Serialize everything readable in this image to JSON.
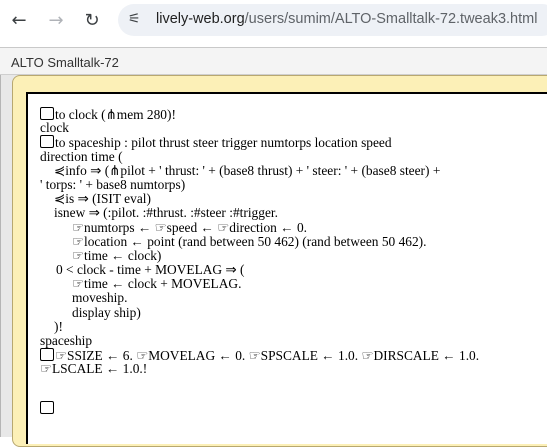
{
  "browser": {
    "back_glyph": "←",
    "forward_glyph": "→",
    "reload_glyph": "↻",
    "site_info_glyph": "⚟",
    "url_host": "lively-web.org",
    "url_path": "/users/sumim/ALTO-Smalltalk-72.tweak3.html"
  },
  "app": {
    "title": "ALTO Smalltalk-72"
  },
  "code": {
    "l1": "to clock (⋔mem 280)!",
    "l2": "clock",
    "l3": "to spaceship : pilot thrust steer trigger numtorps location speed",
    "l4": "direction time (",
    "l5": "⋞info ⇒ (⋔pilot + ' thrust: ' + (base8 thrust) + ' steer: ' + (base8 steer) +",
    "l6": "' torps: ' + base8 numtorps)",
    "l7": "⋞is ⇒ (ISIT eval)",
    "l8": "isnew ⇒ (:pilot. :#thrust. :#steer :#trigger.",
    "l9": "☞numtorps ← ☞speed ← ☞direction ← 0.",
    "l10": "☞location ← point (rand between 50 462) (rand between 50 462).",
    "l11": "☞time ← clock)",
    "l12": "0 < clock - time + MOVELAG ⇒ (",
    "l13": "☞time ← clock + MOVELAG.",
    "l14": "moveship.",
    "l15": "display ship)",
    "l16": ")!",
    "l17": "spaceship",
    "l18": "☞SSIZE ← 6. ☞MOVELAG ← 0. ☞SPSCALE ← 1.0. ☞DIRSCALE ← 1.0.",
    "l19": "☞LSCALE ← 1.0.!"
  }
}
